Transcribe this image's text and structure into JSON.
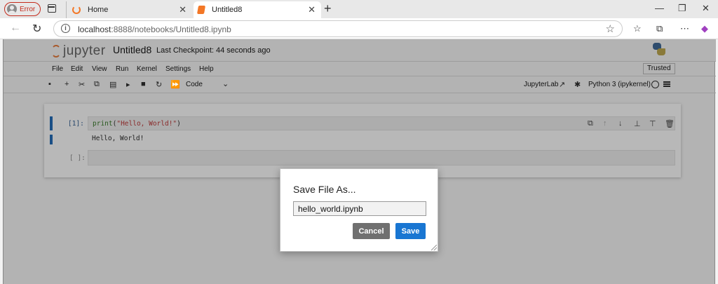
{
  "browser": {
    "profile_label": "Error",
    "tabs": [
      {
        "title": "Home"
      },
      {
        "title": "Untitled8"
      }
    ],
    "url_host": "localhost",
    "url_rest": ":8888/notebooks/Untitled8.ipynb",
    "accent": "#c42b1c"
  },
  "jupyter": {
    "logo_text": "jupyter",
    "notebook_title": "Untitled8",
    "checkpoint": "Last Checkpoint: 44 seconds ago",
    "menu": [
      "File",
      "Edit",
      "View",
      "Run",
      "Kernel",
      "Settings",
      "Help"
    ],
    "trusted": "Trusted",
    "cell_type": "Code",
    "jupyterlab_link": "JupyterLab",
    "kernel_name": "Python 3 (ipykernel)"
  },
  "cells": [
    {
      "prompt": "[1]:",
      "code_fn": "print",
      "code_open": "(",
      "code_str": "\"Hello, World!\"",
      "code_close": ")",
      "output": "Hello, World!"
    },
    {
      "prompt": "[ ]:"
    }
  ],
  "dialog": {
    "title": "Save File As...",
    "filename": "hello_world.ipynb",
    "cancel_label": "Cancel",
    "save_label": "Save",
    "save_color": "#1976d2"
  }
}
